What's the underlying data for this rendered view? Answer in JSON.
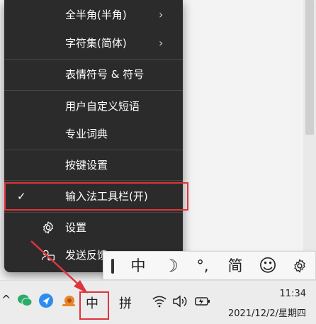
{
  "menu": {
    "items": [
      {
        "label": "全半角(半角)",
        "has_submenu": true
      },
      {
        "label": "字符集(简体)",
        "has_submenu": true
      },
      {
        "label": "表情符号 & 符号",
        "has_submenu": false
      },
      {
        "label": "用户自定义短语",
        "has_submenu": false
      },
      {
        "label": "专业词典",
        "has_submenu": false
      },
      {
        "label": "按键设置",
        "has_submenu": false
      },
      {
        "label": "输入法工具栏(开)",
        "checked": true
      },
      {
        "label": "设置",
        "icon": "gear-icon"
      },
      {
        "label": "发送反馈",
        "icon": "feedback-icon"
      }
    ],
    "chevron": "›",
    "check": "✓"
  },
  "ime_toolbar": {
    "mode": "中",
    "moon": "☽",
    "punct": "°,",
    "simplified": "简",
    "emoji": "☺",
    "settings_icon": "gear-icon"
  },
  "taskbar": {
    "overflow_chevron": "^",
    "ime_mode": "中",
    "ime_name": "拼",
    "time": "11:34",
    "date": "2021/12/2/星期四"
  },
  "colors": {
    "menu_bg": "#2b2b2b",
    "highlight": "#e0343b"
  }
}
